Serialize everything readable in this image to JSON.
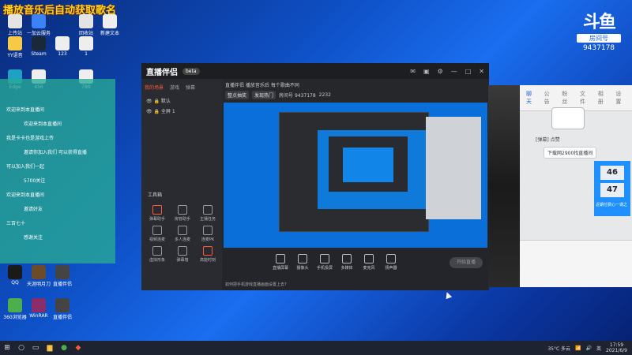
{
  "overlay": {
    "title": "播放音乐后自动获取歌名"
  },
  "douyu": {
    "mark": "斗鱼",
    "room_label": "房间号",
    "room_id": "9437178"
  },
  "desktop_icons": [
    {
      "label": "上传站",
      "color": "#e4e4e4"
    },
    {
      "label": "一加云服务器",
      "color": "#3b82f6"
    },
    {
      "label": "回收站",
      "color": "#e4e4e4"
    },
    {
      "label": "新建文本",
      "color": "#eeeeee"
    },
    {
      "label": "YY语音",
      "color": "#f7c948"
    },
    {
      "label": "Steam",
      "color": "#1b2838"
    },
    {
      "label": "123",
      "color": "#eeeeee"
    },
    {
      "label": "1",
      "color": "#eeeeee"
    },
    {
      "label": "Edge",
      "color": "#1fa1c4"
    },
    {
      "label": "456",
      "color": "#eeeeee"
    },
    {
      "label": "789",
      "color": "#eeeeee"
    },
    {
      "label": "QQ",
      "color": "#1a1a1a"
    },
    {
      "label": "天涯明月刀",
      "color": "#6a4c2a"
    },
    {
      "label": "直播伴侣",
      "color": "#444444"
    },
    {
      "label": "360浏览器",
      "color": "#4cae4c"
    },
    {
      "label": "WinRAR",
      "color": "#8a2d6a"
    },
    {
      "label": "直播伴侣",
      "color": "#444444"
    }
  ],
  "chat_panel": {
    "messages": [
      "欢迎来到本直播间",
      "欢迎来到本直播间",
      "我是卡卡也是游戏上传",
      "邀请你加入我们 可以获得直播",
      "可以加入我们一起",
      "5700关注",
      "欢迎来到本直播间",
      "邀请好友",
      "三百七十",
      "感谢关注"
    ]
  },
  "live_app": {
    "logo": "直播伴侣",
    "version": "beta",
    "side_tabs": [
      "我的场景",
      "游戏",
      "弹幕"
    ],
    "active_tab": "我的场景",
    "scenes": [
      "默认",
      "全屏 1"
    ],
    "tools_title": "工具箱",
    "tools": [
      "弹幕助手",
      "房管助手",
      "主播任务",
      "视频连麦",
      "多人连麦",
      "连麦PK",
      "虚拟形象",
      "弹幕墙",
      "高能时刻"
    ],
    "info_title": "直播伴侣 播放音乐后 每个歌曲不同",
    "info_row": [
      "整点抽奖",
      "发现热门",
      "房间号 9437178",
      "2232"
    ],
    "bottom_tools": [
      "直播屏幕",
      "摄像头",
      "手机投屏",
      "多媒体",
      "麦克风",
      "扬声器"
    ],
    "start_button": "开始直播",
    "tip": "如何把手机游戏直播画面设置上去?"
  },
  "danmu": {
    "tabs": [
      "聊天",
      "公告",
      "粉丝",
      "文件",
      "相册",
      "设置"
    ],
    "active_tab": "聊天",
    "lines": [
      "[弹幕] 点赞",
      "下载网2900找直播间",
      "近期付费心一课之"
    ],
    "counter": [
      "46",
      "47"
    ]
  },
  "taskbar": {
    "weather": "35°C 多云",
    "time": "17:59",
    "date": "2021/6/9",
    "ime": "英"
  }
}
